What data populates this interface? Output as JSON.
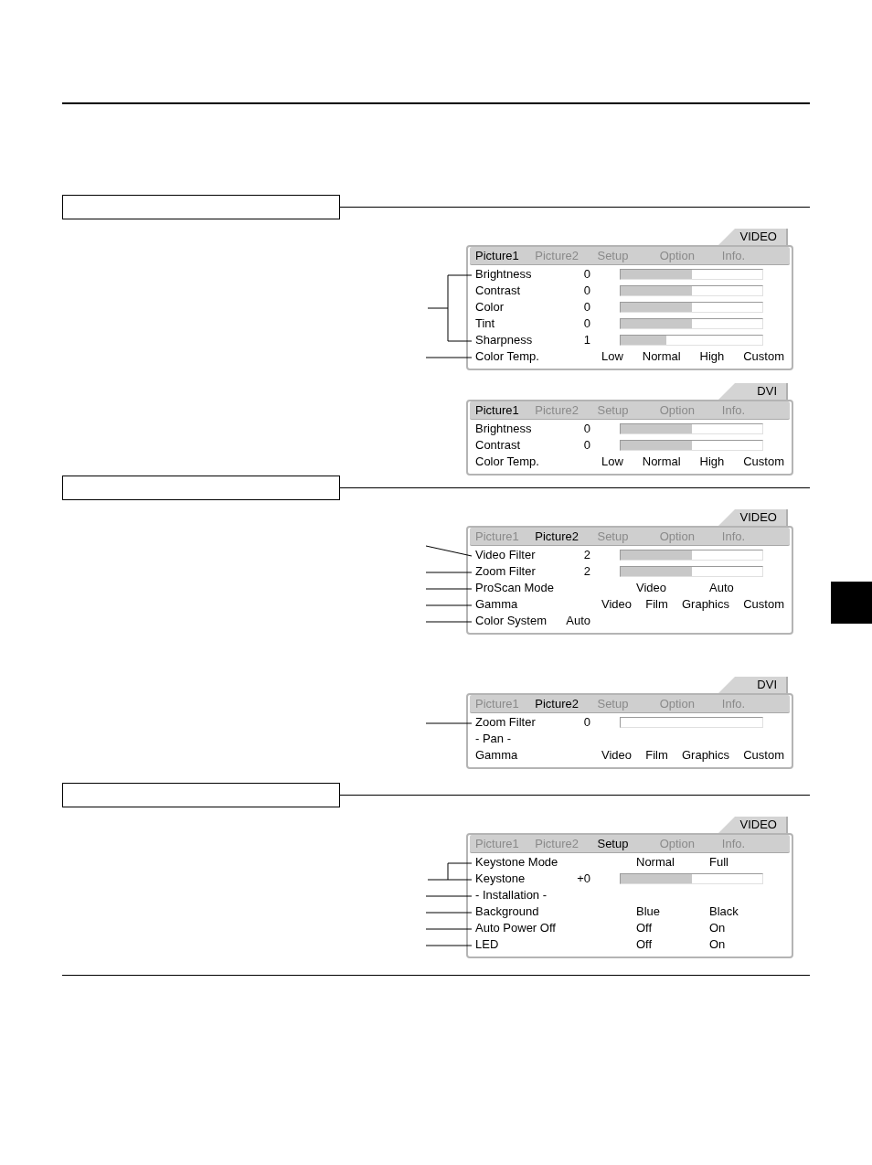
{
  "menus": [
    {
      "source": "VIDEO",
      "tabs": [
        {
          "label": "Picture1",
          "selected": true
        },
        {
          "label": "Picture2",
          "selected": false
        },
        {
          "label": "Setup",
          "selected": false
        },
        {
          "label": "Option",
          "selected": false
        },
        {
          "label": "Info.",
          "selected": false
        }
      ],
      "rows": [
        {
          "kind": "slider",
          "label": "Brightness",
          "value": "0",
          "level": 0.5
        },
        {
          "kind": "slider",
          "label": "Contrast",
          "value": "0",
          "level": 0.5
        },
        {
          "kind": "slider",
          "label": "Color",
          "value": "0",
          "level": 0.5
        },
        {
          "kind": "slider",
          "label": "Tint",
          "value": "0",
          "level": 0.5
        },
        {
          "kind": "slider",
          "label": "Sharpness",
          "value": "1",
          "level": 0.32
        },
        {
          "kind": "options",
          "label": "Color Temp.",
          "options": [
            "Low",
            "Normal",
            "High",
            "Custom"
          ]
        }
      ]
    },
    {
      "source": "DVI",
      "tabs": [
        {
          "label": "Picture1",
          "selected": true
        },
        {
          "label": "Picture2",
          "selected": false
        },
        {
          "label": "Setup",
          "selected": false
        },
        {
          "label": "Option",
          "selected": false
        },
        {
          "label": "Info.",
          "selected": false
        }
      ],
      "rows": [
        {
          "kind": "slider",
          "label": "Brightness",
          "value": "0",
          "level": 0.5
        },
        {
          "kind": "slider",
          "label": "Contrast",
          "value": "0",
          "level": 0.5
        },
        {
          "kind": "options",
          "label": "Color Temp.",
          "options": [
            "Low",
            "Normal",
            "High",
            "Custom"
          ]
        }
      ]
    },
    {
      "source": "VIDEO",
      "tabs": [
        {
          "label": "Picture1",
          "selected": false
        },
        {
          "label": "Picture2",
          "selected": true
        },
        {
          "label": "Setup",
          "selected": false
        },
        {
          "label": "Option",
          "selected": false
        },
        {
          "label": "Info.",
          "selected": false
        }
      ],
      "rows": [
        {
          "kind": "slider",
          "label": "Video Filter",
          "value": "2",
          "level": 0.5
        },
        {
          "kind": "slider",
          "label": "Zoom Filter",
          "value": "2",
          "level": 0.5
        },
        {
          "kind": "options",
          "label": "ProScan Mode",
          "options": [
            "Video",
            "Auto"
          ]
        },
        {
          "kind": "options",
          "label": "Gamma",
          "options": [
            "Video",
            "Film",
            "Graphics",
            "Custom"
          ]
        },
        {
          "kind": "text",
          "label": "Color System",
          "value": "Auto"
        }
      ]
    },
    {
      "source": "DVI",
      "tabs": [
        {
          "label": "Picture1",
          "selected": false
        },
        {
          "label": "Picture2",
          "selected": true
        },
        {
          "label": "Setup",
          "selected": false
        },
        {
          "label": "Option",
          "selected": false
        },
        {
          "label": "Info.",
          "selected": false
        }
      ],
      "rows": [
        {
          "kind": "slider",
          "label": "Zoom Filter",
          "value": "0",
          "level": 0
        },
        {
          "kind": "heading",
          "label": "- Pan -"
        },
        {
          "kind": "options",
          "label": "Gamma",
          "options": [
            "Video",
            "Film",
            "Graphics",
            "Custom"
          ]
        }
      ]
    },
    {
      "source": "VIDEO",
      "tabs": [
        {
          "label": "Picture1",
          "selected": false
        },
        {
          "label": "Picture2",
          "selected": false
        },
        {
          "label": "Setup",
          "selected": true
        },
        {
          "label": "Option",
          "selected": false
        },
        {
          "label": "Info.",
          "selected": false
        }
      ],
      "rows": [
        {
          "kind": "options",
          "label": "Keystone Mode",
          "options": [
            "Normal",
            "Full"
          ]
        },
        {
          "kind": "slider",
          "label": "Keystone",
          "value": "+0",
          "level": 0.5
        },
        {
          "kind": "heading",
          "label": "- Installation -"
        },
        {
          "kind": "options",
          "label": "Background",
          "options": [
            "Blue",
            "Black"
          ]
        },
        {
          "kind": "options",
          "label": "Auto Power Off",
          "options": [
            "Off",
            "On"
          ]
        },
        {
          "kind": "options",
          "label": "LED",
          "options": [
            "Off",
            "On"
          ]
        }
      ]
    }
  ]
}
